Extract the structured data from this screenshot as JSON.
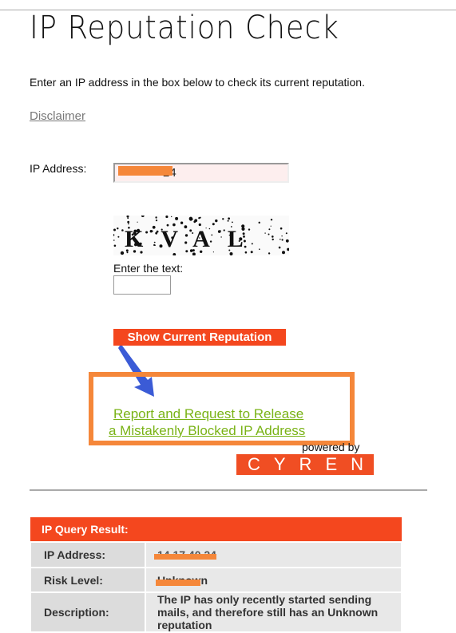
{
  "title": "IP Reputation Check",
  "intro": "Enter an IP address in the box below to check its current reputation.",
  "disclaimer": "Disclaimer",
  "form": {
    "ip_label": "IP Address:",
    "ip_value_visible": "24",
    "captcha_text": "KVAL",
    "enter_text_label": "Enter the text:",
    "submit_label": "Show Current Reputation"
  },
  "report_link": {
    "line1": "Report and Request to Release",
    "line2": "a Mistakenly Blocked IP Address"
  },
  "powered_by": "powered by",
  "logo_text": "CYREN",
  "result": {
    "header": "IP Query Result:",
    "rows": [
      {
        "label": "IP Address:",
        "value": "14.17.40.24"
      },
      {
        "label": "Risk Level:",
        "value": "Unknown"
      },
      {
        "label": "Description:",
        "value": "The IP has only recently started sending mails, and therefore still has an Unknown reputation"
      }
    ]
  },
  "colors": {
    "accent": "#f4471e",
    "link": "#7ab317",
    "highlight_box": "#f5873a",
    "arrow": "#3b5bd6",
    "redaction": "#f5873a"
  }
}
